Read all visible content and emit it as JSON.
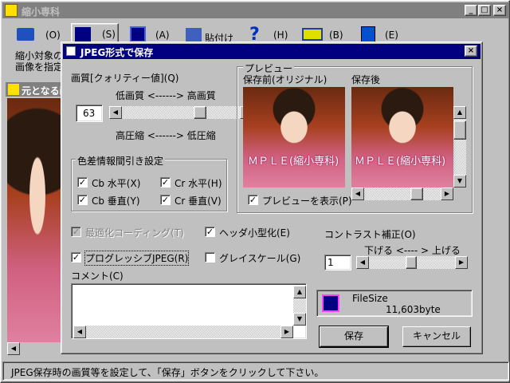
{
  "main_window": {
    "title": "縮小専科",
    "controls": [
      "_",
      "□",
      "×"
    ],
    "toolbar": [
      {
        "key": "(O)",
        "icon": "open-folder-icon"
      },
      {
        "key": "(S)",
        "icon": "select-icon"
      },
      {
        "key": "(A)",
        "icon": "save-disk-icon"
      },
      {
        "key": "貼付け",
        "icon": "paste-icon"
      },
      {
        "key": "(H)",
        "icon": "help-icon"
      },
      {
        "key": "(B)",
        "icon": "banner-icon"
      },
      {
        "key": "(E)",
        "icon": "exit-icon"
      }
    ],
    "hint_line1": "縮小対象の",
    "hint_line2": "画像を指定",
    "source_panel_title": "元となる画",
    "status_text": "JPEG保存時の画質等を設定して、「保存」ボタンをクリックして下さい。"
  },
  "dialog": {
    "title": "JPEG形式で保存",
    "quality": {
      "label": "画質[クォリティー値](Q)",
      "low_quality": "低画質 <------> 高画質",
      "value": "63",
      "compression": "高圧縮 <------> 低圧縮",
      "level": 0.63
    },
    "chroma": {
      "label": "色差情報間引き設定",
      "cb_h": "Cb 水平(X)",
      "cr_h": "Cr 水平(H)",
      "cb_v": "Cb 垂直(Y)",
      "cr_v": "Cr 垂直(V)"
    },
    "optimize": "最適化コーディング(T)",
    "header_small": "ヘッダ小型化(E)",
    "progressive": "プログレッシブJPEG(R)",
    "grayscale": "グレイスケール(G)",
    "comment_label": "コメント(C)",
    "comment_value": "",
    "preview": {
      "label": "プレビュー",
      "before": "保存前(オリジナル)",
      "after": "保存後",
      "watermark": "ＭＰＬＥ(縮小専科)",
      "show_label": "プレビューを表示(P)"
    },
    "contrast": {
      "label": "コントラスト補正(O)",
      "range": "下げる <---- > 上げる",
      "value": "1"
    },
    "filesize": {
      "label": "FileSize",
      "value": "11,603byte"
    },
    "save_button": "保存",
    "cancel_button": "キャンセル"
  }
}
